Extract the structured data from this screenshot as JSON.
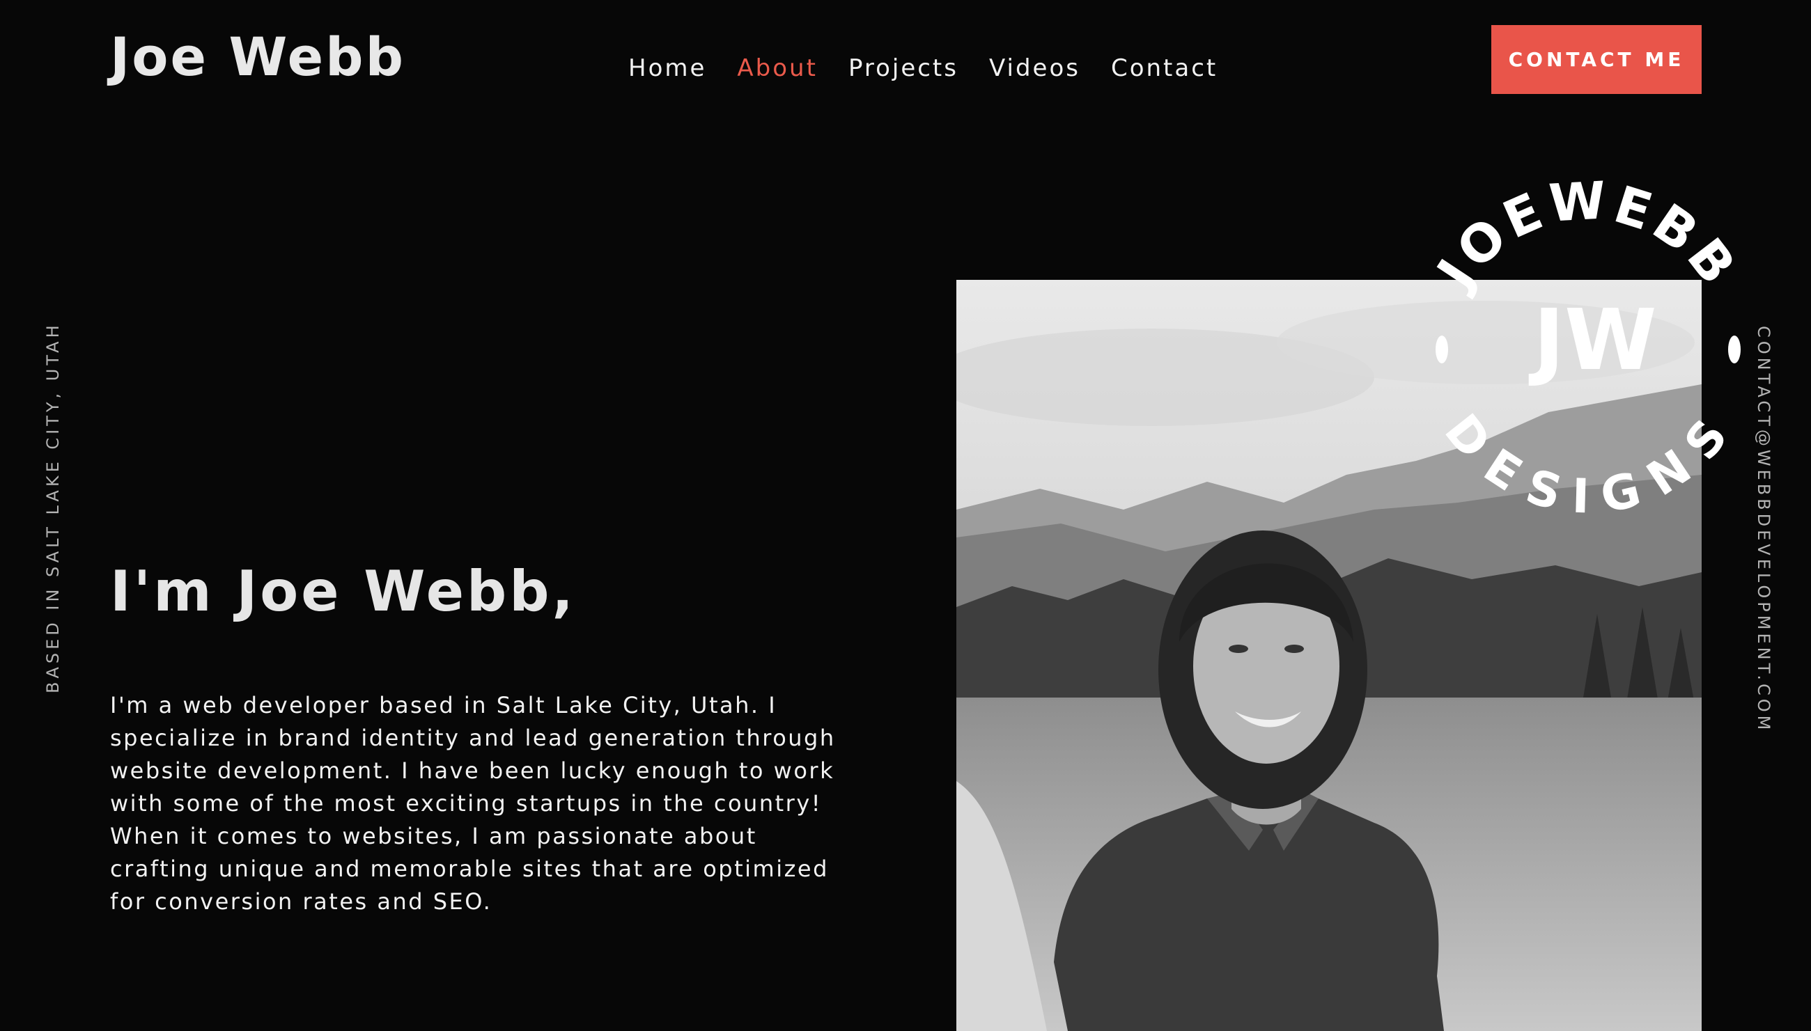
{
  "header": {
    "logo": "Joe Webb",
    "nav": [
      {
        "label": "Home",
        "active": false
      },
      {
        "label": "About",
        "active": true
      },
      {
        "label": "Projects",
        "active": false
      },
      {
        "label": "Videos",
        "active": false
      },
      {
        "label": "Contact",
        "active": false
      }
    ],
    "cta_label": "CONTACT ME"
  },
  "side": {
    "left_text": "BASED IN SALT LAKE CITY, UTAH",
    "right_text": "CONTACT@WEBBDEVELOPMENT.COM"
  },
  "hero": {
    "title": "I'm Joe Webb,",
    "body": "I'm a web developer based in Salt Lake City, Utah. I specialize in brand identity and lead generation through website development. I have been lucky enough to work with some of the most exciting startups in the country! When it comes to websites, I am passionate about crafting unique and memorable sites that are optimized for conversion rates and SEO."
  },
  "badge": {
    "top_text": "JOEWEBB",
    "bottom_text": "DESIGNS",
    "monogram": "JW"
  },
  "photo": {
    "subject": "portrait-of-man-in-mountain-meadow"
  },
  "colors": {
    "background": "#070707",
    "accent": "#e9554a",
    "text": "#ffffff",
    "muted": "#b3b3b3"
  }
}
